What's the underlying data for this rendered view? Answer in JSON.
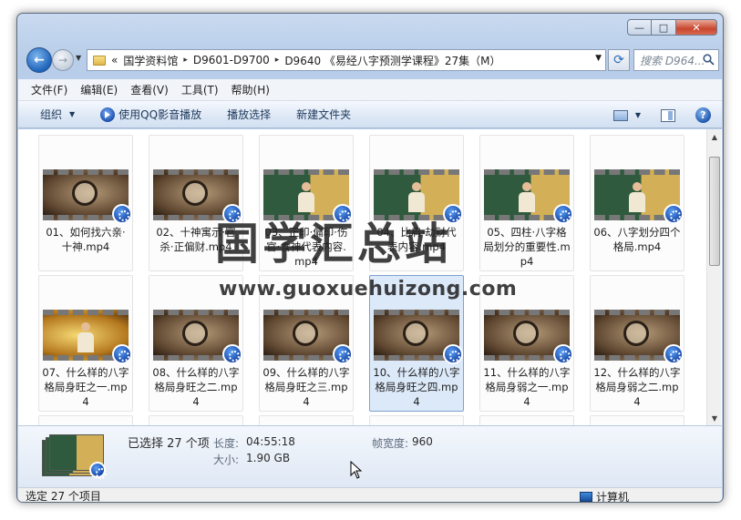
{
  "window": {
    "minimize": "—",
    "maximize": "□",
    "close": "✕"
  },
  "nav": {
    "back_glyph": "←",
    "forward_glyph": "→",
    "recent_glyph": "▼",
    "breadcrumb": [
      "«",
      "国学资料馆",
      "D9601-D9700",
      "D9640 《易经八字预测学课程》27集（M）"
    ],
    "separator": "▸",
    "dropdown_glyph": "▼",
    "refresh_glyph": "⟳",
    "search_placeholder": "搜索 D964..."
  },
  "menubar": [
    "文件(F)",
    "编辑(E)",
    "查看(V)",
    "工具(T)",
    "帮助(H)"
  ],
  "toolbar": {
    "organize": "组织",
    "dropdown_glyph": "▼",
    "play_qq": "使用QQ影音播放",
    "play_select": "播放选择",
    "new_folder": "新建文件夹",
    "help_glyph": "?"
  },
  "files": [
    {
      "label": "01、如何找六亲·十神.mp4",
      "thumb": "map"
    },
    {
      "label": "02、十神寓示·官杀·正偏财.mp4",
      "thumb": "map"
    },
    {
      "label": "03、正印·偏印·伤官·食神代表内容.mp4",
      "thumb": "board"
    },
    {
      "label": "04、比肩·劫财代表内容.mp4",
      "thumb": "board"
    },
    {
      "label": "05、四柱·八字格局划分的重要性.mp4",
      "thumb": "board"
    },
    {
      "label": "06、八字划分四个格局.mp4",
      "thumb": "board"
    },
    {
      "label": "07、什么样的八字格局身旺之一.mp4",
      "thumb": "yellow"
    },
    {
      "label": "08、什么样的八字格局身旺之二.mp4",
      "thumb": "map"
    },
    {
      "label": "09、什么样的八字格局身旺之三.mp4",
      "thumb": "map"
    },
    {
      "label": "10、什么样的八字格局身旺之四.mp4",
      "thumb": "map",
      "selected": true
    },
    {
      "label": "11、什么样的八字格局身弱之一.mp4",
      "thumb": "map"
    },
    {
      "label": "12、什么样的八字格局身弱之二.mp4",
      "thumb": "map"
    }
  ],
  "scroll": {
    "up": "▲",
    "down": "▼"
  },
  "watermark": {
    "cn": "国学汇总站",
    "url": "www.guoxuehuizong.com"
  },
  "details": {
    "selected": "已选择 27 个项",
    "length_key": "长度:",
    "length_val": "04:55:18",
    "size_key": "大小:",
    "size_val": "1.90 GB",
    "width_key": "帧宽度:",
    "width_val": "960"
  },
  "status": {
    "left": "选定 27 个项目",
    "right": "计算机"
  }
}
